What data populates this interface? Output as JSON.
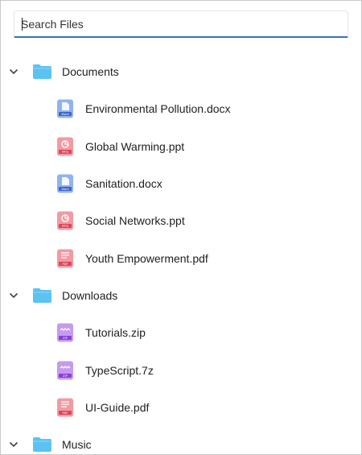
{
  "search": {
    "placeholder": "Search Files",
    "value": ""
  },
  "colors": {
    "accent": "#3b6fb6",
    "folder": "#5cc2f2",
    "word": "#6f9be6",
    "ppt": "#ef7d86",
    "pdf": "#ef7d86",
    "zip": "#b276ea"
  },
  "tree": [
    {
      "label": "Documents",
      "icon": "folder-icon",
      "expanded": true
    },
    {
      "label": "Environmental Pollution.docx",
      "icon": "word-doc-icon",
      "badge": "Word"
    },
    {
      "label": "Global Warming.ppt",
      "icon": "ppt-icon",
      "badge": "PPTX"
    },
    {
      "label": "Sanitation.docx",
      "icon": "word-doc-icon",
      "badge": "Word"
    },
    {
      "label": "Social Networks.ppt",
      "icon": "ppt-icon",
      "badge": "PPTX"
    },
    {
      "label": "Youth Empowerment.pdf",
      "icon": "pdf-icon",
      "badge": "PDF"
    },
    {
      "label": "Downloads",
      "icon": "folder-icon",
      "expanded": true
    },
    {
      "label": "Tutorials.zip",
      "icon": "zip-icon",
      "badge": "ZIP"
    },
    {
      "label": "TypeScript.7z",
      "icon": "zip-icon",
      "badge": "ZIP"
    },
    {
      "label": "UI-Guide.pdf",
      "icon": "pdf-icon",
      "badge": "PDF"
    },
    {
      "label": "Music",
      "icon": "folder-icon",
      "expanded": true
    }
  ]
}
